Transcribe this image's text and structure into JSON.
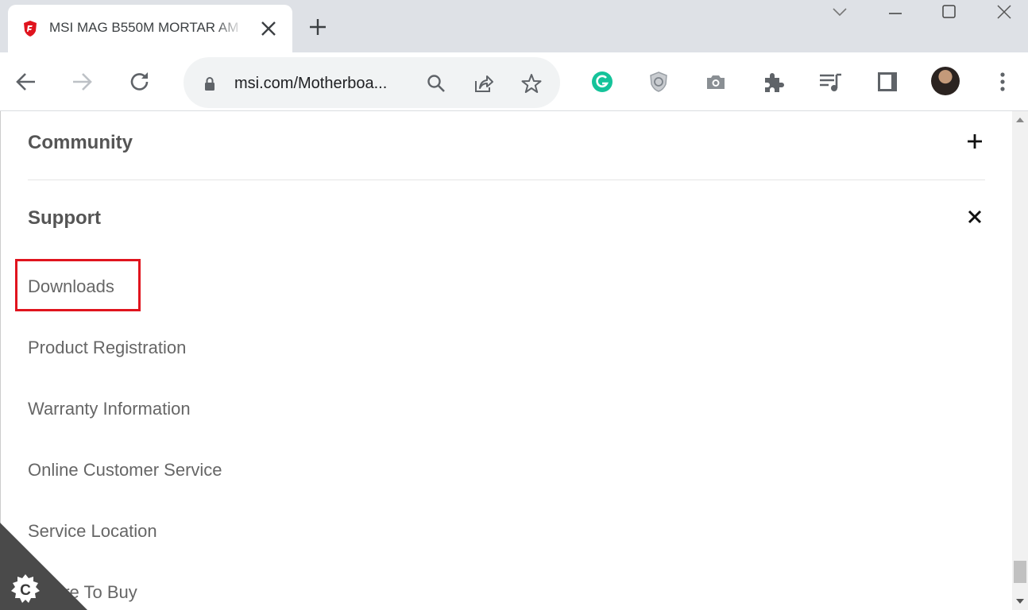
{
  "browser": {
    "tab": {
      "title": "MSI MAG B550M MORTAR AM",
      "favicon": "msi-shield-icon",
      "close_icon": "close-icon"
    },
    "new_tab_icon": "plus-icon",
    "window_controls": [
      "chevron-down-icon",
      "minimize-icon",
      "maximize-icon",
      "close-icon"
    ],
    "toolbar": {
      "back_icon": "arrow-left-icon",
      "forward_icon": "arrow-right-icon",
      "reload_icon": "reload-icon",
      "url": "msi.com/Motherboa...",
      "omnibox_icons": [
        "search-icon",
        "share-icon",
        "star-icon"
      ],
      "extensions": [
        "grammarly-icon",
        "shield-extension-icon",
        "camera-icon",
        "puzzle-icon",
        "media-playlist-icon",
        "side-panel-icon",
        "profile-avatar",
        "kebab-menu-icon"
      ]
    },
    "colors": {
      "highlight": "#e0141e",
      "grammarly": "#15c39a",
      "msi_red": "#e0141e"
    }
  },
  "page": {
    "sections": [
      {
        "title": "Community",
        "toggle": "+"
      },
      {
        "title": "Support",
        "toggle": "×"
      }
    ],
    "support_links": [
      "Downloads",
      "Product Registration",
      "Warranty Information",
      "Online Customer Service",
      "Service Location",
      "Where To Buy"
    ],
    "highlighted_link": "Downloads",
    "corner_badge_letter": "C"
  }
}
